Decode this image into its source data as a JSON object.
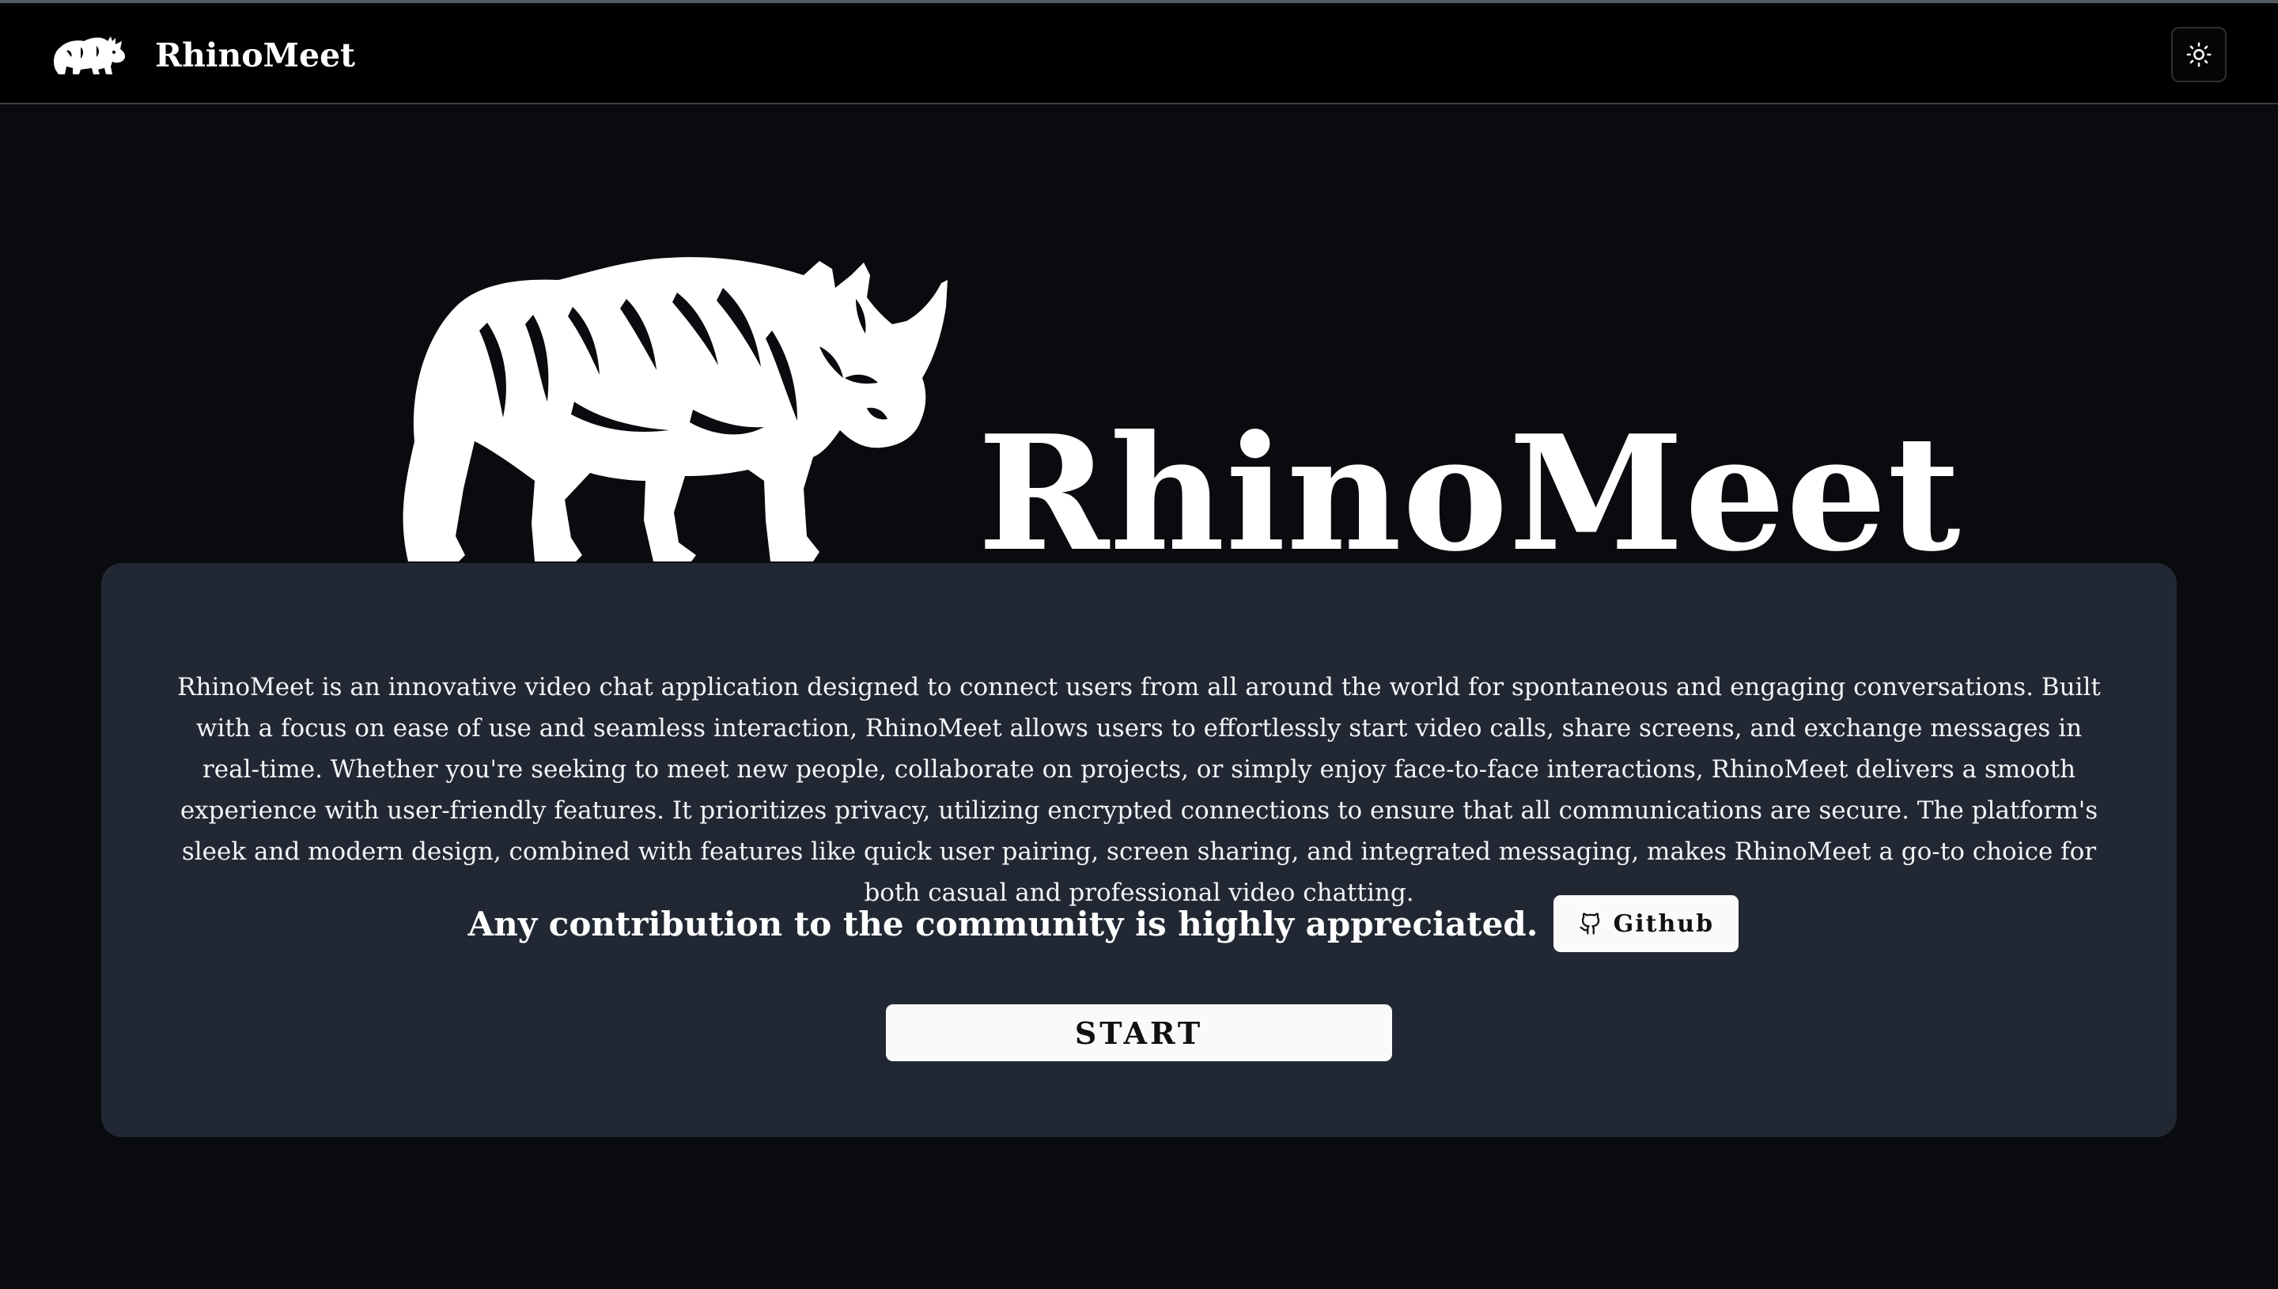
{
  "navbar": {
    "title": "RhinoMeet",
    "logo_icon": "rhino-logo-icon",
    "theme_toggle_icon": "sun-icon"
  },
  "hero": {
    "title": "RhinoMeet",
    "illustration_icon": "rhino-illustration"
  },
  "card": {
    "description": "RhinoMeet is an innovative video chat application designed to connect users from all around the world for spontaneous and engaging conversations. Built with a focus on ease of use and seamless interaction, RhinoMeet allows users to effortlessly start video calls, share screens, and exchange messages in real-time. Whether you're seeking to meet new people, collaborate on projects, or simply enjoy face-to-face interactions, RhinoMeet delivers a smooth experience with user-friendly features. It prioritizes privacy, utilizing encrypted connections to ensure that all communications are secure. The platform's sleek and modern design, combined with features like quick user pairing, screen sharing, and integrated messaging, makes RhinoMeet a go-to choice for both casual and professional video chatting.",
    "contribution_text": "Any contribution to the community is highly appreciated.",
    "github_label": "Github",
    "github_icon": "github-icon",
    "start_label": "START"
  },
  "colors": {
    "page_background": "#0a0b0e",
    "navbar_background": "#000000",
    "card_background": "#222833",
    "button_background": "#fafafa",
    "text": "#ffffff"
  }
}
